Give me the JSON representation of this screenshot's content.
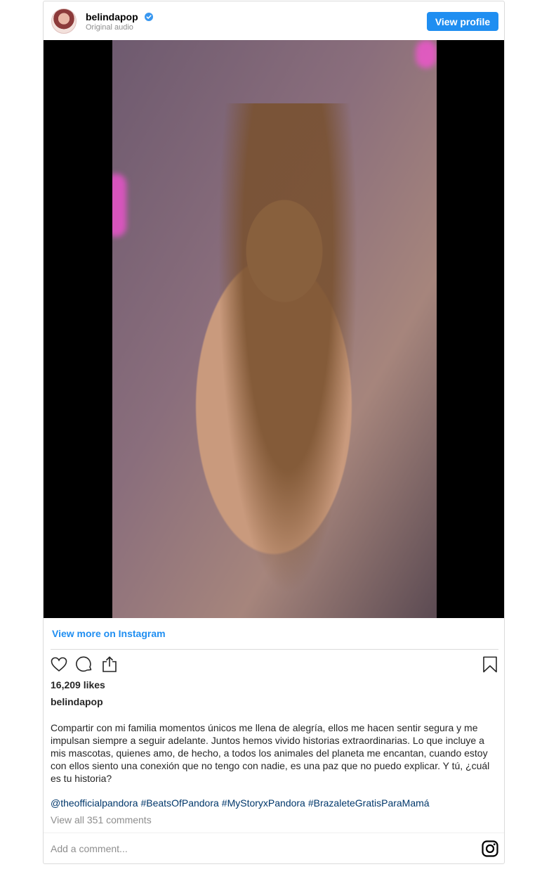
{
  "header": {
    "username": "belindapop",
    "subtitle": "Original audio",
    "view_profile_label": "View profile"
  },
  "media": {
    "alt": "Photo of woman wearing silver charm bracelets and head jewelry"
  },
  "footer": {
    "view_more_label": "View more on Instagram",
    "likes": "16,209 likes",
    "caption_username": "belindapop",
    "caption": "Compartir con mi familia momentos únicos me llena de alegría, ellos me hacen sentir segura y me impulsan siempre a seguir adelante. Juntos hemos vivido historias extraordinarias. Lo que incluye a mis mascotas, quienes amo, de hecho, a todos los animales del planeta me encantan, cuando estoy con ellos siento una conexión que no tengo con nadie, es una paz que no puedo explicar. Y tú, ¿cuál es tu historia?",
    "tags": [
      "@theofficialpandora",
      "#BeatsOfPandora",
      "#MyStoryxPandora",
      "#BrazaleteGratisParaMamá"
    ],
    "view_comments": "View all 351 comments",
    "add_comment_placeholder": "Add a comment..."
  },
  "colors": {
    "accent": "#1f8ef1",
    "link": "#00376b",
    "muted": "#8e8e8e",
    "border": "#dbdbdb"
  },
  "icons": [
    "verified-badge-icon",
    "heart-icon",
    "comment-icon",
    "share-icon",
    "bookmark-icon",
    "instagram-icon"
  ]
}
